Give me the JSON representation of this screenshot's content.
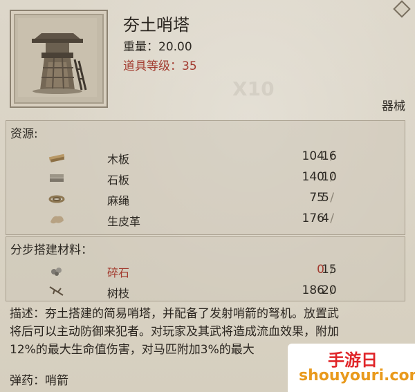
{
  "item": {
    "name": "夯土哨塔",
    "weight_label": "重量：20.00",
    "level_label": "道具等级：35",
    "category": "器械",
    "icon": "watchtower-icon"
  },
  "resources": {
    "title": "资源:",
    "items": [
      {
        "icon": "wood-plank-icon",
        "name": "木板",
        "have": "104",
        "need": "16"
      },
      {
        "icon": "stone-slab-icon",
        "name": "石板",
        "have": "140",
        "need": "10"
      },
      {
        "icon": "rope-icon",
        "name": "麻绳",
        "have": "75",
        "need": "5"
      },
      {
        "icon": "rawhide-icon",
        "name": "生皮革",
        "have": "176",
        "need": "4"
      }
    ]
  },
  "materials": {
    "title": "分步搭建材料：",
    "items": [
      {
        "icon": "gravel-icon",
        "name": "碎石",
        "have": "0",
        "need": "15",
        "short": true
      },
      {
        "icon": "branch-icon",
        "name": "树枝",
        "have": "186",
        "need": "20",
        "short": false
      }
    ]
  },
  "description": {
    "line1": "描述：夯土搭建的简易哨塔，并配备了发射哨箭的弩机。放置武",
    "line2": "将后可以主动防御来犯者。对玩家及其武将造成流血效果，附加",
    "line3": "12%的最大生命值伤害，对马匹附加3%的最大"
  },
  "ammo_label": "弹药：哨箭",
  "watermarks": {
    "stack": "X10"
  },
  "site_logo": {
    "line1": "手游日",
    "line2": "shouyouri.com"
  },
  "colors": {
    "warning_red": "#a23a2e",
    "logo_red": "#e0262a",
    "logo_orange": "#e99a1d"
  }
}
